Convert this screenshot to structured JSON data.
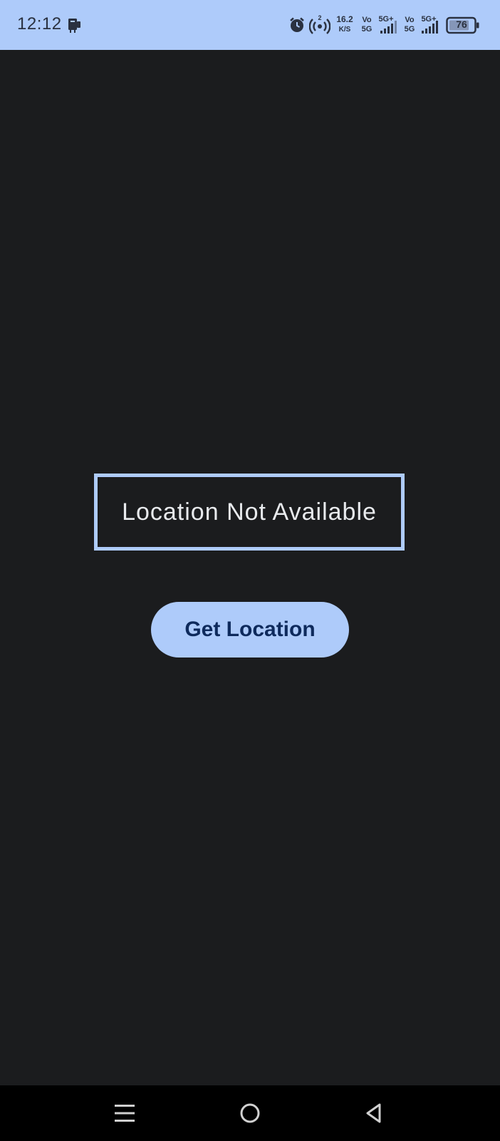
{
  "status_bar": {
    "time": "12:12",
    "net_speed_value": "16.2",
    "net_speed_unit": "K/S",
    "hotspot_count": "2",
    "sim1_top": "Vo",
    "sim1_bottom": "5G",
    "sim1_network": "5G+",
    "sim2_top": "Vo",
    "sim2_bottom": "5G",
    "sim2_network": "5G+",
    "battery": "76",
    "icons": [
      "notification-icon",
      "alarm-icon",
      "hotspot-icon",
      "signal-icon",
      "signal-icon",
      "battery-icon"
    ]
  },
  "main": {
    "location_text": "Location Not Available",
    "button_label": "Get Location"
  },
  "nav_bar": {
    "icons": [
      "menu-icon",
      "home-icon",
      "back-icon"
    ]
  },
  "colors": {
    "accent": "#aecbfa",
    "background": "#1b1c1e",
    "button_text": "#0e2a5c",
    "text": "#e8eaed"
  }
}
